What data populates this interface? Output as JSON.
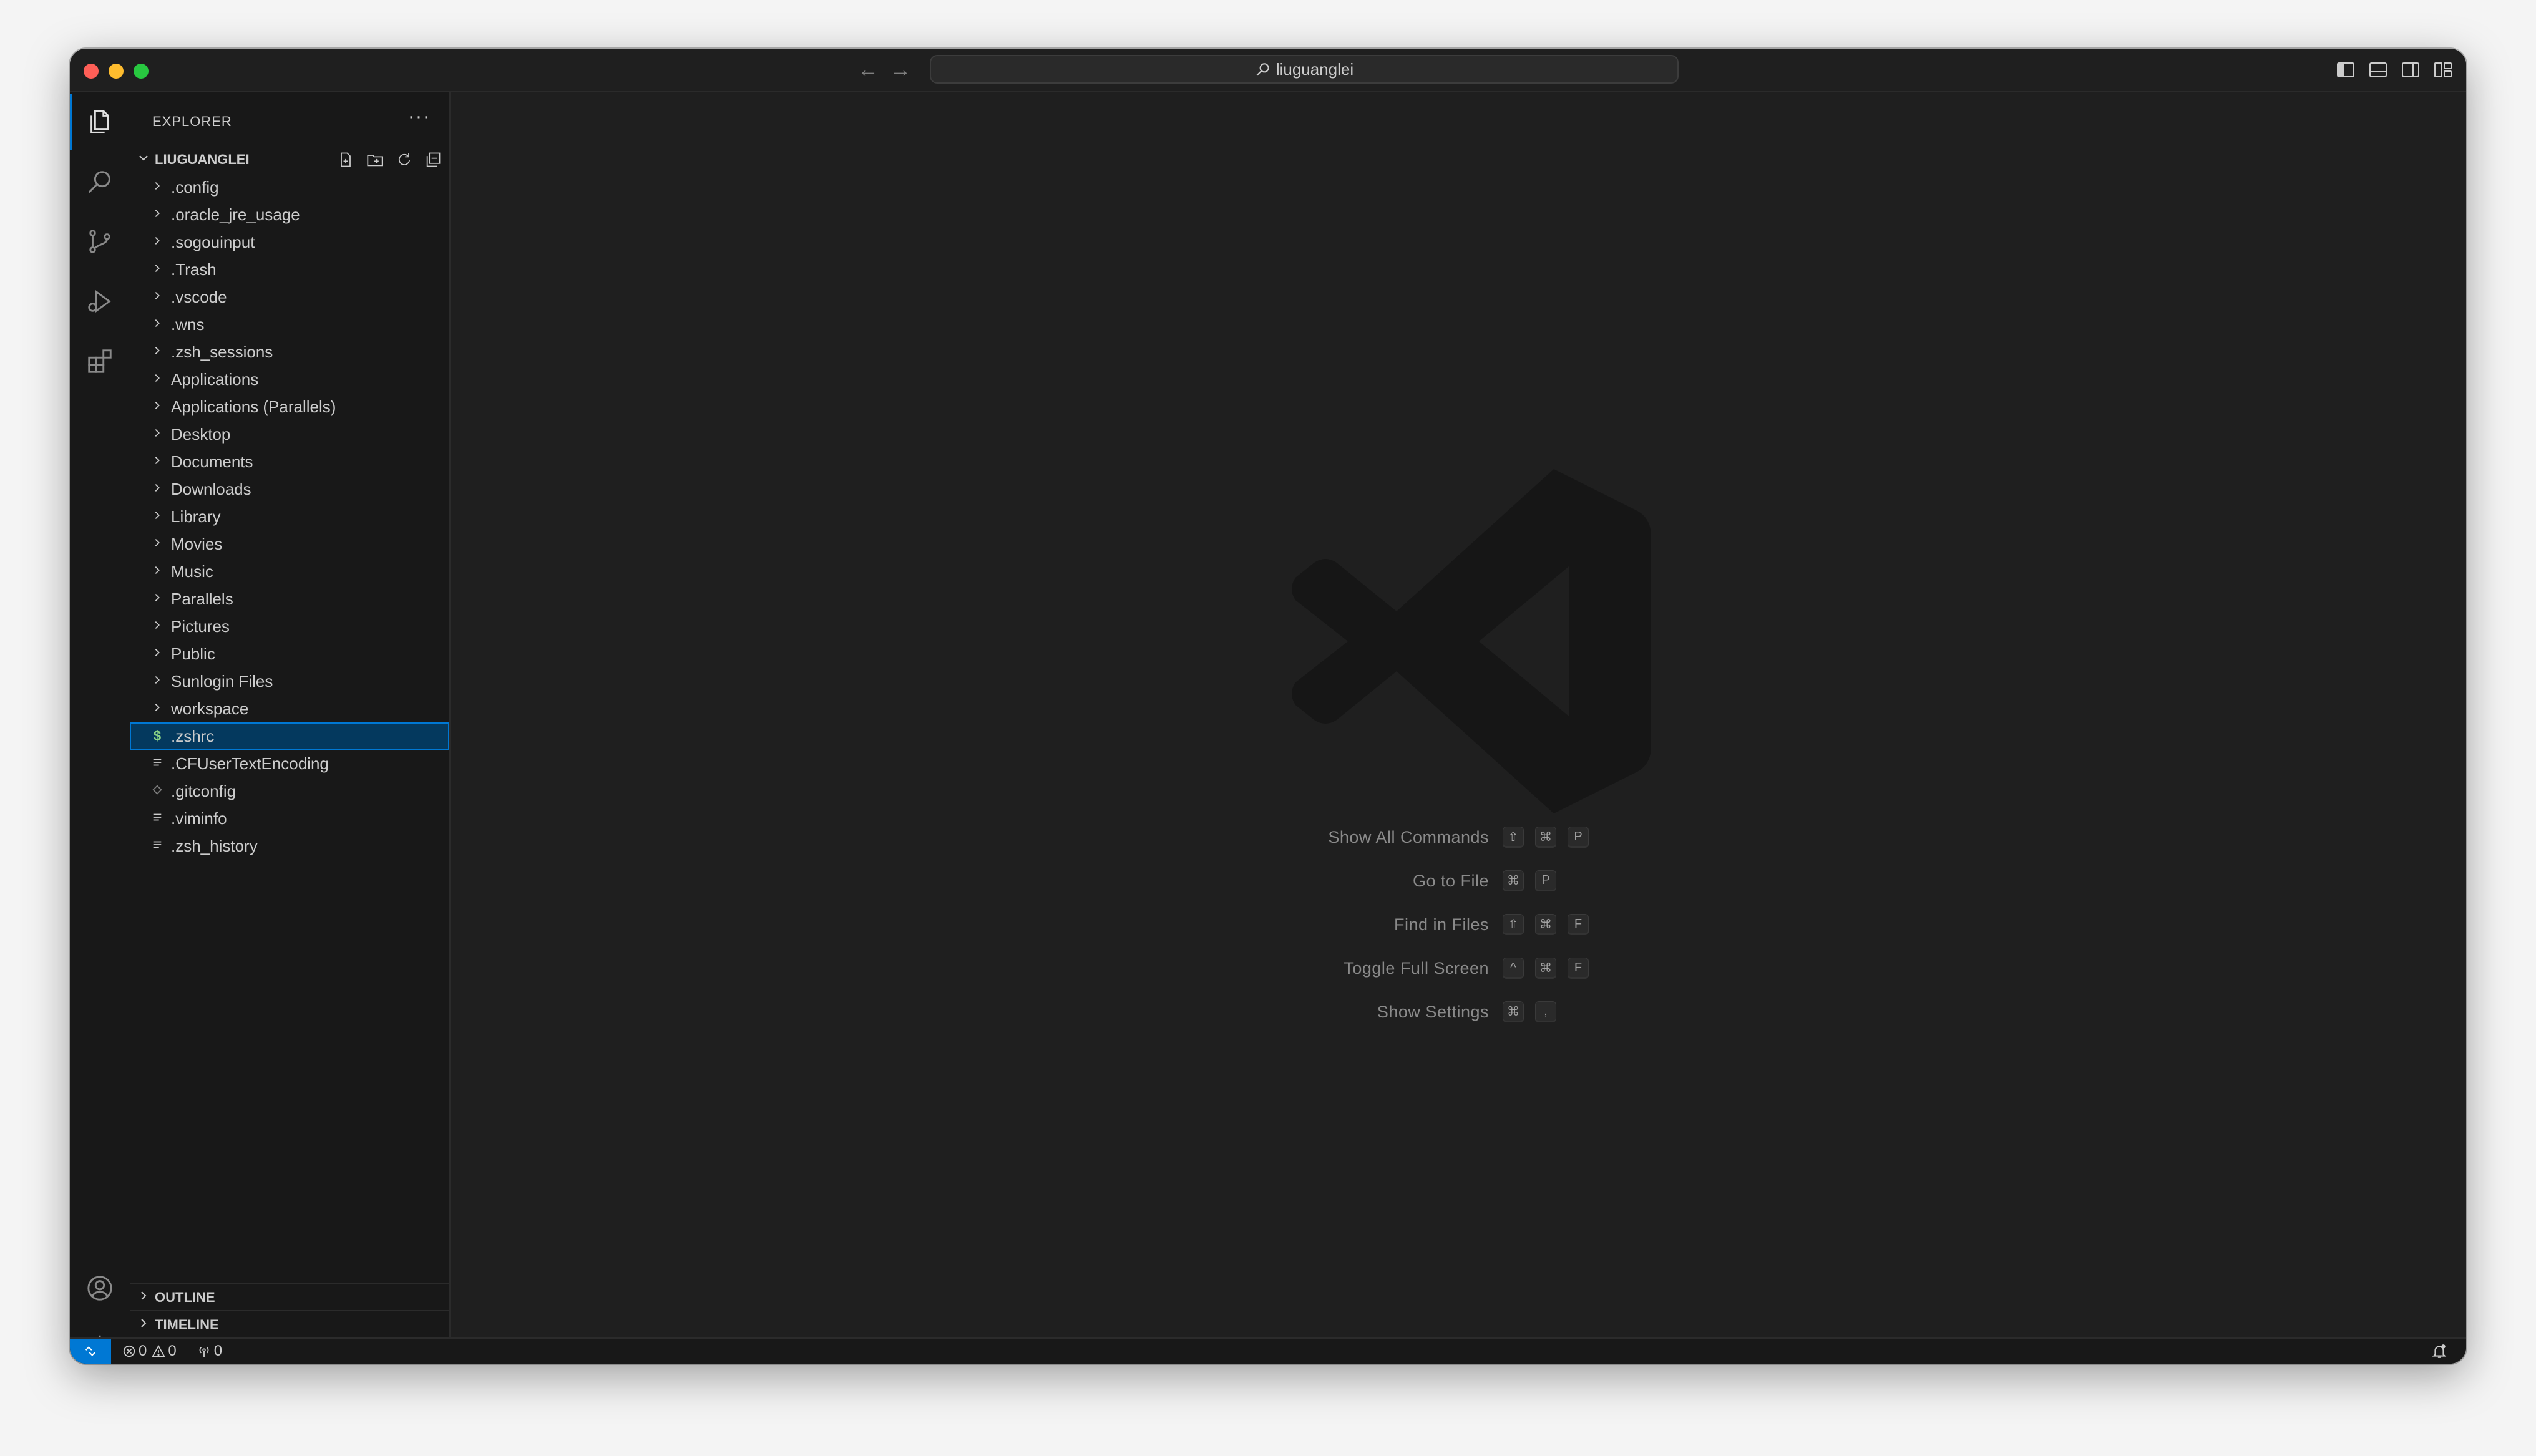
{
  "window": {
    "title": "liuguanglei"
  },
  "sidebar": {
    "title": "EXPLORER",
    "more": "···",
    "folder_name": "LIUGUANGLEI",
    "items": [
      {
        "label": ".config",
        "type": "folder"
      },
      {
        "label": ".oracle_jre_usage",
        "type": "folder"
      },
      {
        "label": ".sogouinput",
        "type": "folder"
      },
      {
        "label": ".Trash",
        "type": "folder"
      },
      {
        "label": ".vscode",
        "type": "folder"
      },
      {
        "label": ".wns",
        "type": "folder"
      },
      {
        "label": ".zsh_sessions",
        "type": "folder"
      },
      {
        "label": "Applications",
        "type": "folder"
      },
      {
        "label": "Applications (Parallels)",
        "type": "folder"
      },
      {
        "label": "Desktop",
        "type": "folder"
      },
      {
        "label": "Documents",
        "type": "folder"
      },
      {
        "label": "Downloads",
        "type": "folder"
      },
      {
        "label": "Library",
        "type": "folder"
      },
      {
        "label": "Movies",
        "type": "folder"
      },
      {
        "label": "Music",
        "type": "folder"
      },
      {
        "label": "Parallels",
        "type": "folder"
      },
      {
        "label": "Pictures",
        "type": "folder"
      },
      {
        "label": "Public",
        "type": "folder"
      },
      {
        "label": "Sunlogin Files",
        "type": "folder"
      },
      {
        "label": "workspace",
        "type": "folder"
      },
      {
        "label": ".zshrc",
        "type": "shell",
        "selected": true
      },
      {
        "label": ".CFUserTextEncoding",
        "type": "text"
      },
      {
        "label": ".gitconfig",
        "type": "git"
      },
      {
        "label": ".viminfo",
        "type": "text"
      },
      {
        "label": ".zsh_history",
        "type": "text"
      }
    ],
    "outline_label": "OUTLINE",
    "timeline_label": "TIMELINE"
  },
  "editor": {
    "shortcuts": [
      {
        "label": "Show All Commands",
        "keys": [
          "⇧",
          "⌘",
          "P"
        ]
      },
      {
        "label": "Go to File",
        "keys": [
          "⌘",
          "P"
        ]
      },
      {
        "label": "Find in Files",
        "keys": [
          "⇧",
          "⌘",
          "F"
        ]
      },
      {
        "label": "Toggle Full Screen",
        "keys": [
          "^",
          "⌘",
          "F"
        ]
      },
      {
        "label": "Show Settings",
        "keys": [
          "⌘",
          ","
        ]
      }
    ]
  },
  "statusbar": {
    "errors": "0",
    "warnings": "0",
    "ports": "0"
  },
  "icons": {
    "activity": [
      "files-icon",
      "search-icon",
      "source-control-icon",
      "run-debug-icon",
      "extensions-icon",
      "account-icon",
      "settings-gear-icon"
    ],
    "folder_actions": [
      "new-file-icon",
      "new-folder-icon",
      "refresh-icon",
      "collapse-all-icon"
    ]
  },
  "colors": {
    "accent": "#0078d4",
    "selection": "#04395e",
    "shell_icon": "#89d185"
  }
}
